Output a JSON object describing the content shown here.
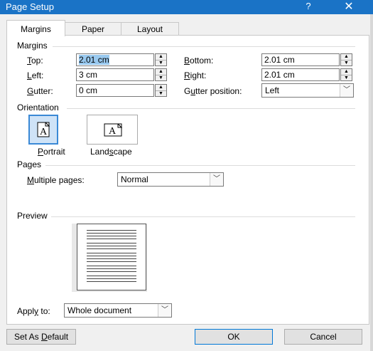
{
  "title": "Page Setup",
  "help_glyph": "?",
  "close_glyph": "✕",
  "tabs": [
    {
      "label": "Margins",
      "active": true
    },
    {
      "label": "Paper",
      "active": false
    },
    {
      "label": "Layout",
      "active": false
    }
  ],
  "margins": {
    "group_label": "Margins",
    "top": {
      "pre": "",
      "key": "T",
      "post": "op:",
      "value": "2.01 cm"
    },
    "left": {
      "pre": "",
      "key": "L",
      "post": "eft:",
      "value": "3 cm"
    },
    "gutter": {
      "pre": "",
      "key": "G",
      "post": "utter:",
      "value": "0 cm"
    },
    "bottom": {
      "pre": "",
      "key": "B",
      "post": "ottom:",
      "value": "2.01 cm"
    },
    "right": {
      "pre": "",
      "key": "R",
      "post": "ight:",
      "value": "2.01 cm"
    },
    "gutter_position": {
      "pre": "G",
      "key": "u",
      "post": "tter position:",
      "value": "Left"
    }
  },
  "orientation": {
    "group_label": "Orientation",
    "portrait": {
      "pre": "",
      "key": "P",
      "post": "ortrait",
      "glyph": "A",
      "selected": true
    },
    "landscape": {
      "pre": "Land",
      "key": "s",
      "post": "cape",
      "glyph": "A",
      "selected": false
    }
  },
  "pages": {
    "group_label": "Pages",
    "multiple_pages": {
      "pre": "",
      "key": "M",
      "post": "ultiple pages:",
      "value": "Normal"
    }
  },
  "preview": {
    "group_label": "Preview"
  },
  "apply_to": {
    "pre": "Appl",
    "key": "y",
    "post": " to:",
    "value": "Whole document"
  },
  "buttons": {
    "set_default": {
      "pre": "Set As ",
      "key": "D",
      "post": "efault"
    },
    "ok": "OK",
    "cancel": "Cancel"
  },
  "colors": {
    "titlebar": "#1a73c6",
    "accent": "#3a89d6",
    "selection": "#99c9ef"
  }
}
